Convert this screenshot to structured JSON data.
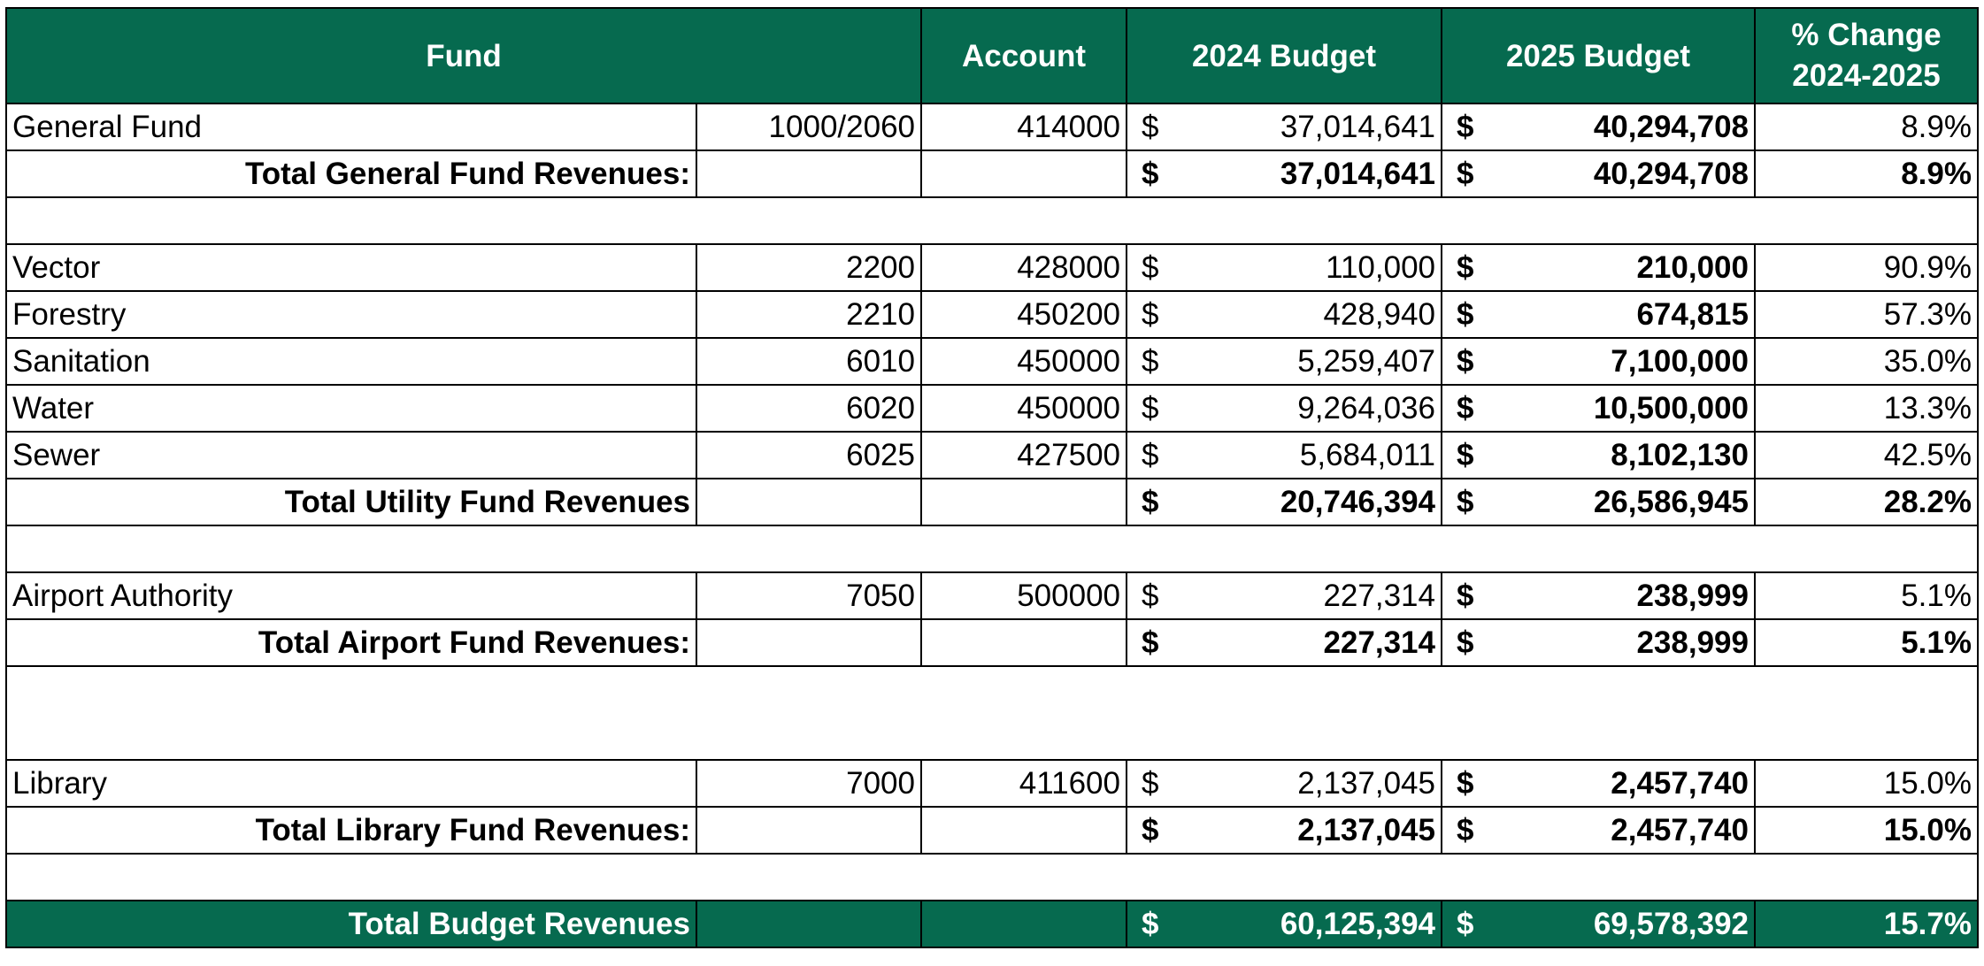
{
  "headers": {
    "fund": "Fund",
    "account": "Account",
    "budget_2024": "2024 Budget",
    "budget_2025": "2025 Budget",
    "pct_change_line1": "% Change",
    "pct_change_line2": "2024-2025"
  },
  "currency": "$",
  "sections": [
    {
      "rows": [
        {
          "fund": "General Fund",
          "fund_no": "1000/2060",
          "account": "414000",
          "b2024": "37,014,641",
          "b2025": "40,294,708",
          "pct": "8.9%"
        }
      ],
      "total": {
        "label": "Total General Fund Revenues:",
        "b2024": "37,014,641",
        "b2025": "40,294,708",
        "pct": "8.9%"
      }
    },
    {
      "rows": [
        {
          "fund": "Vector",
          "fund_no": "2200",
          "account": "428000",
          "b2024": "110,000",
          "b2025": "210,000",
          "pct": "90.9%"
        },
        {
          "fund": "Forestry",
          "fund_no": "2210",
          "account": "450200",
          "b2024": "428,940",
          "b2025": "674,815",
          "pct": "57.3%"
        },
        {
          "fund": "Sanitation",
          "fund_no": "6010",
          "account": "450000",
          "b2024": "5,259,407",
          "b2025": "7,100,000",
          "pct": "35.0%"
        },
        {
          "fund": "Water",
          "fund_no": "6020",
          "account": "450000",
          "b2024": "9,264,036",
          "b2025": "10,500,000",
          "pct": "13.3%"
        },
        {
          "fund": "Sewer",
          "fund_no": "6025",
          "account": "427500",
          "b2024": "5,684,011",
          "b2025": "8,102,130",
          "pct": "42.5%"
        }
      ],
      "total": {
        "label": "Total Utility Fund Revenues",
        "b2024": "20,746,394",
        "b2025": "26,586,945",
        "pct": "28.2%"
      }
    },
    {
      "rows": [
        {
          "fund": "Airport Authority",
          "fund_no": "7050",
          "account": "500000",
          "b2024": "227,314",
          "b2025": "238,999",
          "pct": "5.1%"
        }
      ],
      "total": {
        "label": "Total Airport Fund Revenues:",
        "b2024": "227,314",
        "b2025": "238,999",
        "pct": "5.1%"
      }
    },
    {
      "rows": [
        {
          "fund": "Library",
          "fund_no": "7000",
          "account": "411600",
          "b2024": "2,137,045",
          "b2025": "2,457,740",
          "pct": "15.0%"
        }
      ],
      "total": {
        "label": "Total Library Fund Revenues:",
        "b2024": "2,137,045",
        "b2025": "2,457,740",
        "pct": "15.0%"
      }
    }
  ],
  "grand_total": {
    "label": "Total Budget Revenues",
    "b2024": "60,125,394",
    "b2025": "69,578,392",
    "pct": "15.7%"
  },
  "colors": {
    "header_bg": "#066a4f",
    "header_text": "#ffffff"
  }
}
